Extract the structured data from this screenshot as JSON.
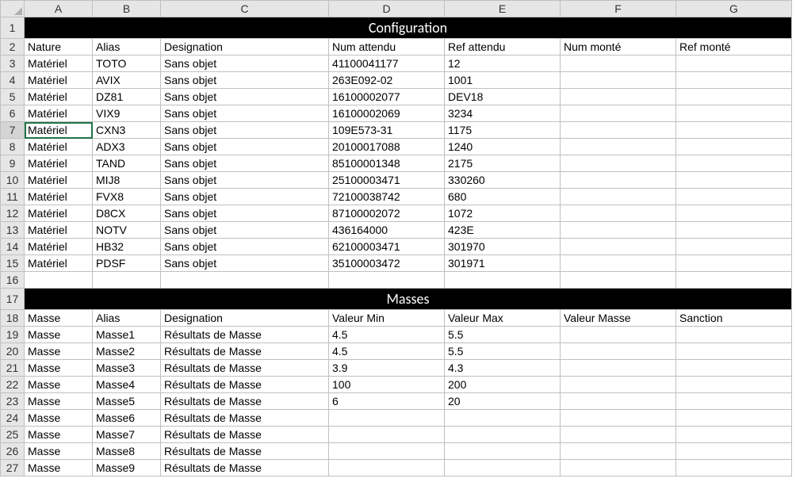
{
  "columns": [
    "A",
    "B",
    "C",
    "D",
    "E",
    "F",
    "G"
  ],
  "rowCount": 27,
  "selectedRow": 7,
  "selectedCol": 0,
  "banners": {
    "1": "Configuration",
    "17": "Masses"
  },
  "rows": {
    "2": [
      "Nature",
      "Alias",
      "Designation",
      "Num attendu",
      "Ref attendu",
      "Num monté",
      "Ref monté"
    ],
    "3": [
      "Matériel",
      "TOTO",
      "Sans objet",
      "41100041177",
      "12",
      "",
      ""
    ],
    "4": [
      "Matériel",
      "AVIX",
      "Sans objet",
      "263E092-02",
      "1001",
      "",
      ""
    ],
    "5": [
      "Matériel",
      "DZ81",
      "Sans objet",
      "16100002077",
      "DEV18",
      "",
      ""
    ],
    "6": [
      "Matériel",
      "VIX9",
      "Sans objet",
      "16100002069",
      "3234",
      "",
      ""
    ],
    "7": [
      "Matériel",
      "CXN3",
      "Sans objet",
      "109E573-31",
      "1175",
      "",
      ""
    ],
    "8": [
      "Matériel",
      "ADX3",
      "Sans objet",
      "20100017088",
      "1240",
      "",
      ""
    ],
    "9": [
      "Matériel",
      "TAND",
      "Sans objet",
      "85100001348",
      "2175",
      "",
      ""
    ],
    "10": [
      "Matériel",
      "MIJ8",
      "Sans objet",
      "25100003471",
      "330260",
      "",
      ""
    ],
    "11": [
      "Matériel",
      "FVX8",
      "Sans objet",
      "72100038742",
      "680",
      "",
      ""
    ],
    "12": [
      "Matériel",
      "D8CX",
      "Sans objet",
      "87100002072",
      "1072",
      "",
      ""
    ],
    "13": [
      "Matériel",
      "NOTV",
      "Sans objet",
      "436164000",
      "423E",
      "",
      ""
    ],
    "14": [
      "Matériel",
      "HB32",
      "Sans objet",
      "62100003471",
      "301970",
      "",
      ""
    ],
    "15": [
      "Matériel",
      "PDSF",
      "Sans objet",
      "35100003472",
      "301971",
      "",
      ""
    ],
    "16": [
      "",
      "",
      "",
      "",
      "",
      "",
      ""
    ],
    "18": [
      "Masse",
      "Alias",
      "Designation",
      "Valeur Min",
      "Valeur Max",
      "Valeur Masse",
      "Sanction"
    ],
    "19": [
      "Masse",
      "Masse1",
      "Résultats de Masse",
      "4.5",
      "5.5",
      "",
      ""
    ],
    "20": [
      "Masse",
      "Masse2",
      "Résultats de Masse",
      "4.5",
      "5.5",
      "",
      ""
    ],
    "21": [
      "Masse",
      "Masse3",
      "Résultats de Masse",
      "3.9",
      "4.3",
      "",
      ""
    ],
    "22": [
      "Masse",
      "Masse4",
      "Résultats de Masse",
      "100",
      "200",
      "",
      ""
    ],
    "23": [
      "Masse",
      "Masse5",
      "Résultats de Masse",
      "6",
      "20",
      "",
      ""
    ],
    "24": [
      "Masse",
      "Masse6",
      "Résultats de Masse",
      "",
      "",
      "",
      ""
    ],
    "25": [
      "Masse",
      "Masse7",
      "Résultats de Masse",
      "",
      "",
      "",
      ""
    ],
    "26": [
      "Masse",
      "Masse8",
      "Résultats de Masse",
      "",
      "",
      "",
      ""
    ],
    "27": [
      "Masse",
      "Masse9",
      "Résultats de Masse",
      "",
      "",
      "",
      ""
    ]
  }
}
